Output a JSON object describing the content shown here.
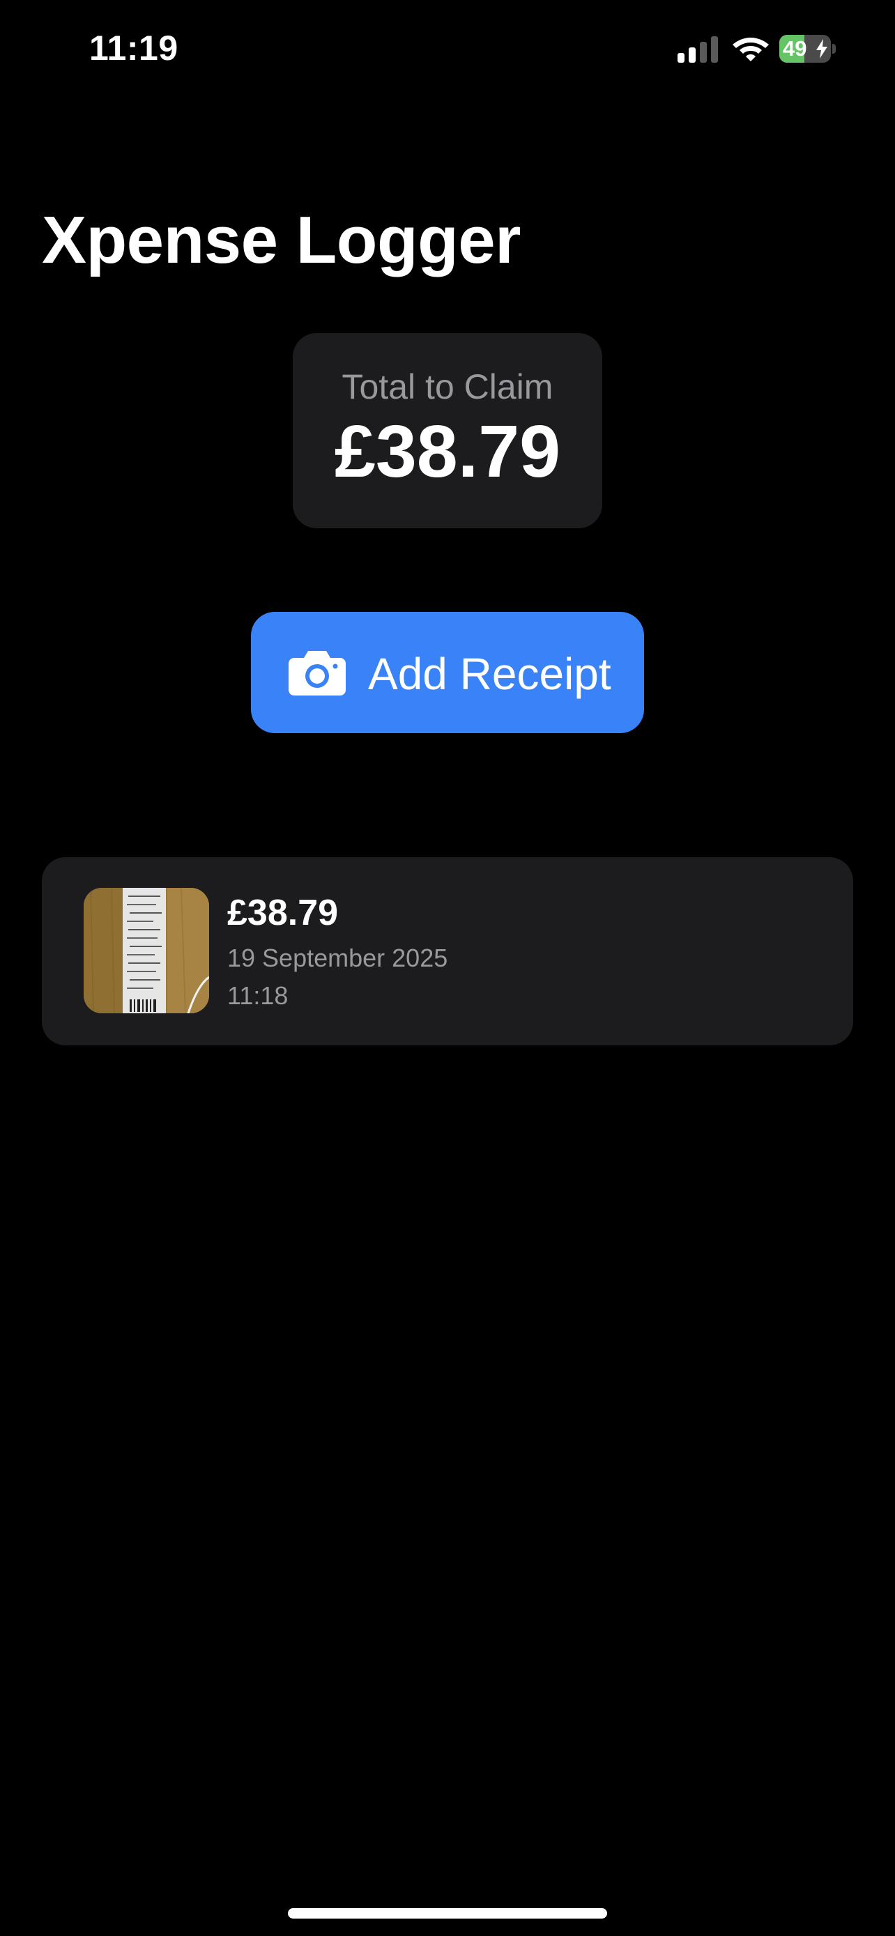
{
  "status_bar": {
    "time": "11:19",
    "battery_level": 49,
    "battery_label": "49",
    "charging": true,
    "signal_bars_active": 2,
    "signal_bars_total": 4
  },
  "app": {
    "title": "Xpense Logger"
  },
  "total": {
    "label": "Total to Claim",
    "amount": "£38.79"
  },
  "add_button": {
    "label": "Add Receipt",
    "icon": "camera-icon"
  },
  "receipts": [
    {
      "amount": "£38.79",
      "date": "19 September 2025",
      "time": "11:18"
    }
  ],
  "colors": {
    "background": "#000000",
    "card": "#1c1c1e",
    "accent": "#3a82f7",
    "secondary_text": "#98989d",
    "battery_green": "#65c466"
  }
}
